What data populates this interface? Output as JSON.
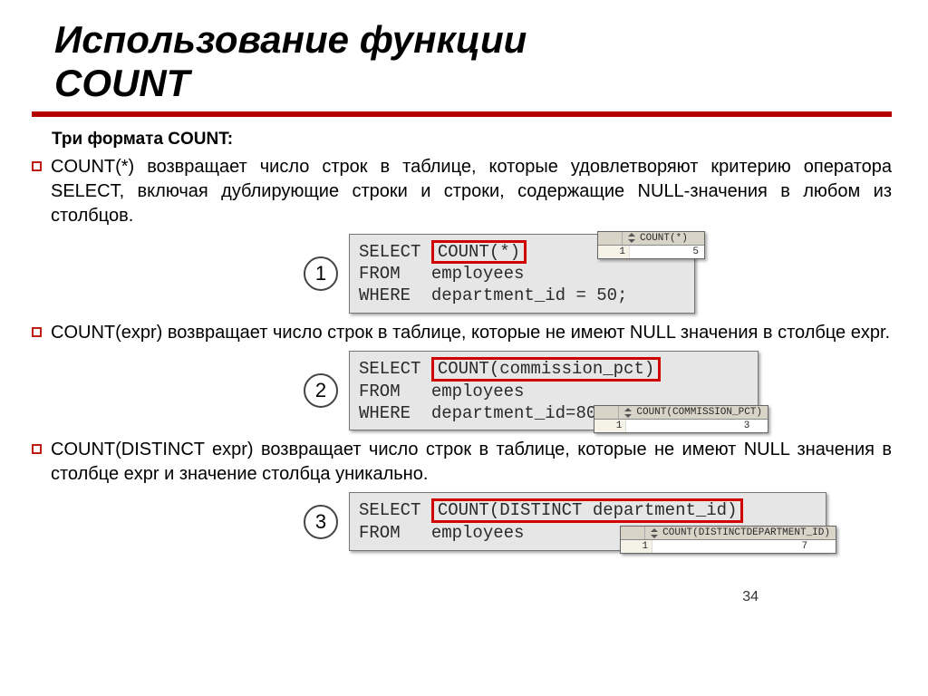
{
  "title_line1": "Использование функции",
  "title_line2": "COUNT",
  "subtitle": "Три формата COUNT:",
  "items": [
    "COUNT(*) возвращает число строк в таблице, которые удовлетворяют критерию оператора SELECT, включая дублирующие строки и строки, содержащие NULL-значения в любом из столбцов.",
    "COUNT(expr) возвращает число строк в таблице, которые не имеют NULL значения в столбце expr.",
    "COUNT(DISTINCT expr) возвращает число строк в таблице, которые не имеют NULL значения в столбце expr и значение столбца уникально."
  ],
  "circles": [
    "1",
    "2",
    "3"
  ],
  "code1": {
    "pre1": "SELECT ",
    "hl": "COUNT(*)",
    "l2": "FROM   employees",
    "l3": "WHERE  department_id = 50;"
  },
  "code2": {
    "pre1": "SELECT ",
    "hl": "COUNT(commission_pct)",
    "l2": "FROM   employees",
    "l3": "WHERE  department_id=80;"
  },
  "code3": {
    "pre1": "SELECT ",
    "hl": "COUNT(DISTINCT department_id)",
    "l2": "FROM   employees"
  },
  "result1": {
    "header": "COUNT(*)",
    "row_idx": "1",
    "value": "5"
  },
  "result2": {
    "header": "COUNT(COMMISSION_PCT)",
    "row_idx": "1",
    "value": "3"
  },
  "result3": {
    "header": "COUNT(DISTINCTDEPARTMENT_ID)",
    "row_idx": "1",
    "value": "7"
  },
  "page_number": "34"
}
